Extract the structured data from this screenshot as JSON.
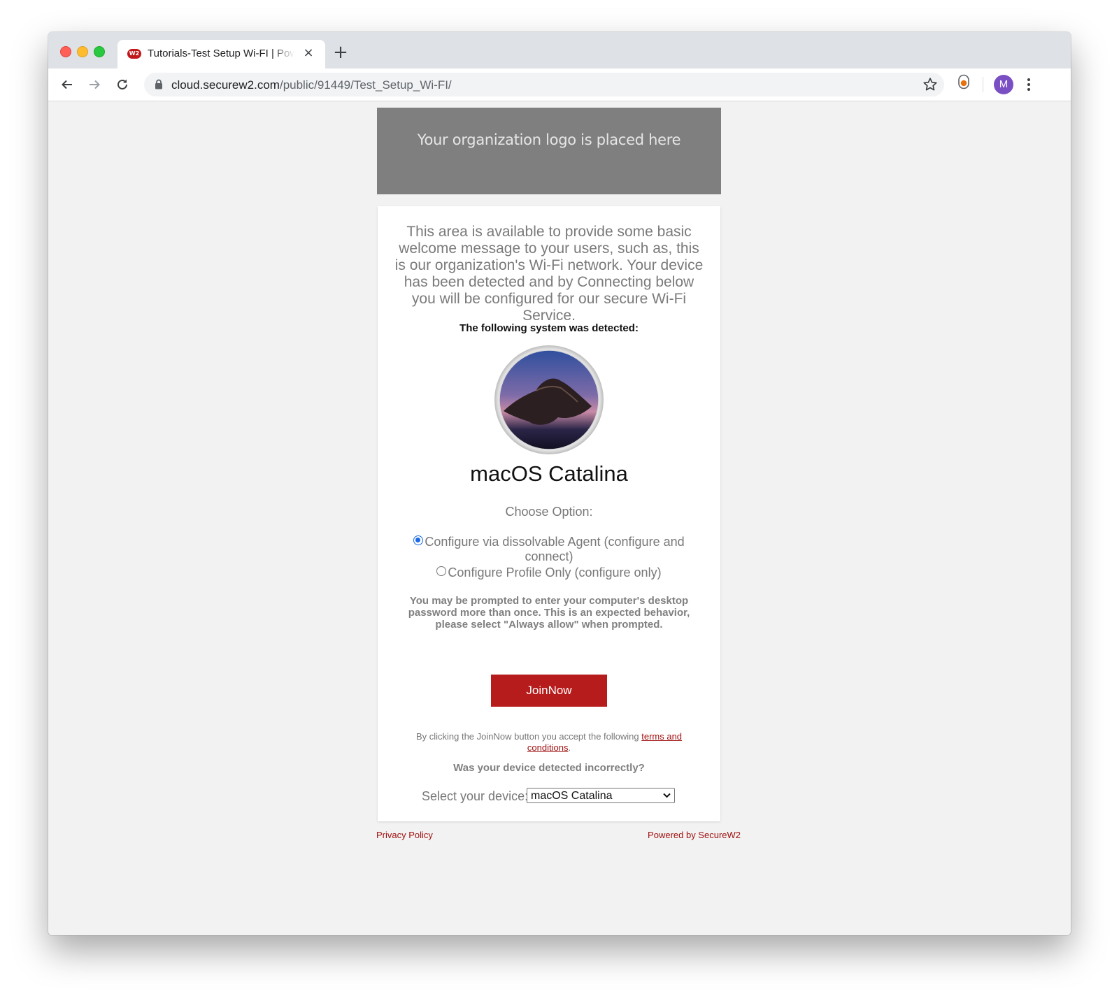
{
  "browser": {
    "tab_favicon": "W2",
    "tab_title": "Tutorials-Test Setup Wi-FI | Powered by SecureW2",
    "tab_close": "×",
    "new_tab": "+",
    "url_host": "cloud.securew2.com",
    "url_path": "/public/91449/Test_Setup_Wi-FI/",
    "profile_initial": "M",
    "profile_color": "#7b4fc4"
  },
  "page": {
    "logo_placeholder": "Your organization logo is placed here",
    "welcome_message": "This area is available to provide some basic welcome message to your users, such as, this is our organization's Wi-Fi network. Your device has been detected and by Connecting below you will be configured for our secure Wi-Fi Service.",
    "detected_heading": "The following system was detected:",
    "os_name": "macOS Catalina",
    "choose_option_label": "Choose Option:",
    "options": [
      {
        "label": "Configure via dissolvable Agent (configure and connect)",
        "selected": true
      },
      {
        "label": "Configure Profile Only (configure only)",
        "selected": false
      }
    ],
    "warning": "You may be prompted to enter your computer's desktop password more than once. This is an expected behavior, please select \"Always allow\" when prompted.",
    "join_button": "JoinNow",
    "terms_prefix": "By clicking the JoinNow button you accept the following ",
    "terms_link": "terms and conditions",
    "terms_suffix": ".",
    "incorrect_question": "Was your device detected incorrectly?",
    "select_label": "Select your device:",
    "select_value": "macOS Catalina",
    "privacy_policy": "Privacy Policy",
    "powered_by": "Powered by SecureW2",
    "accent_color": "#b71c1c"
  }
}
